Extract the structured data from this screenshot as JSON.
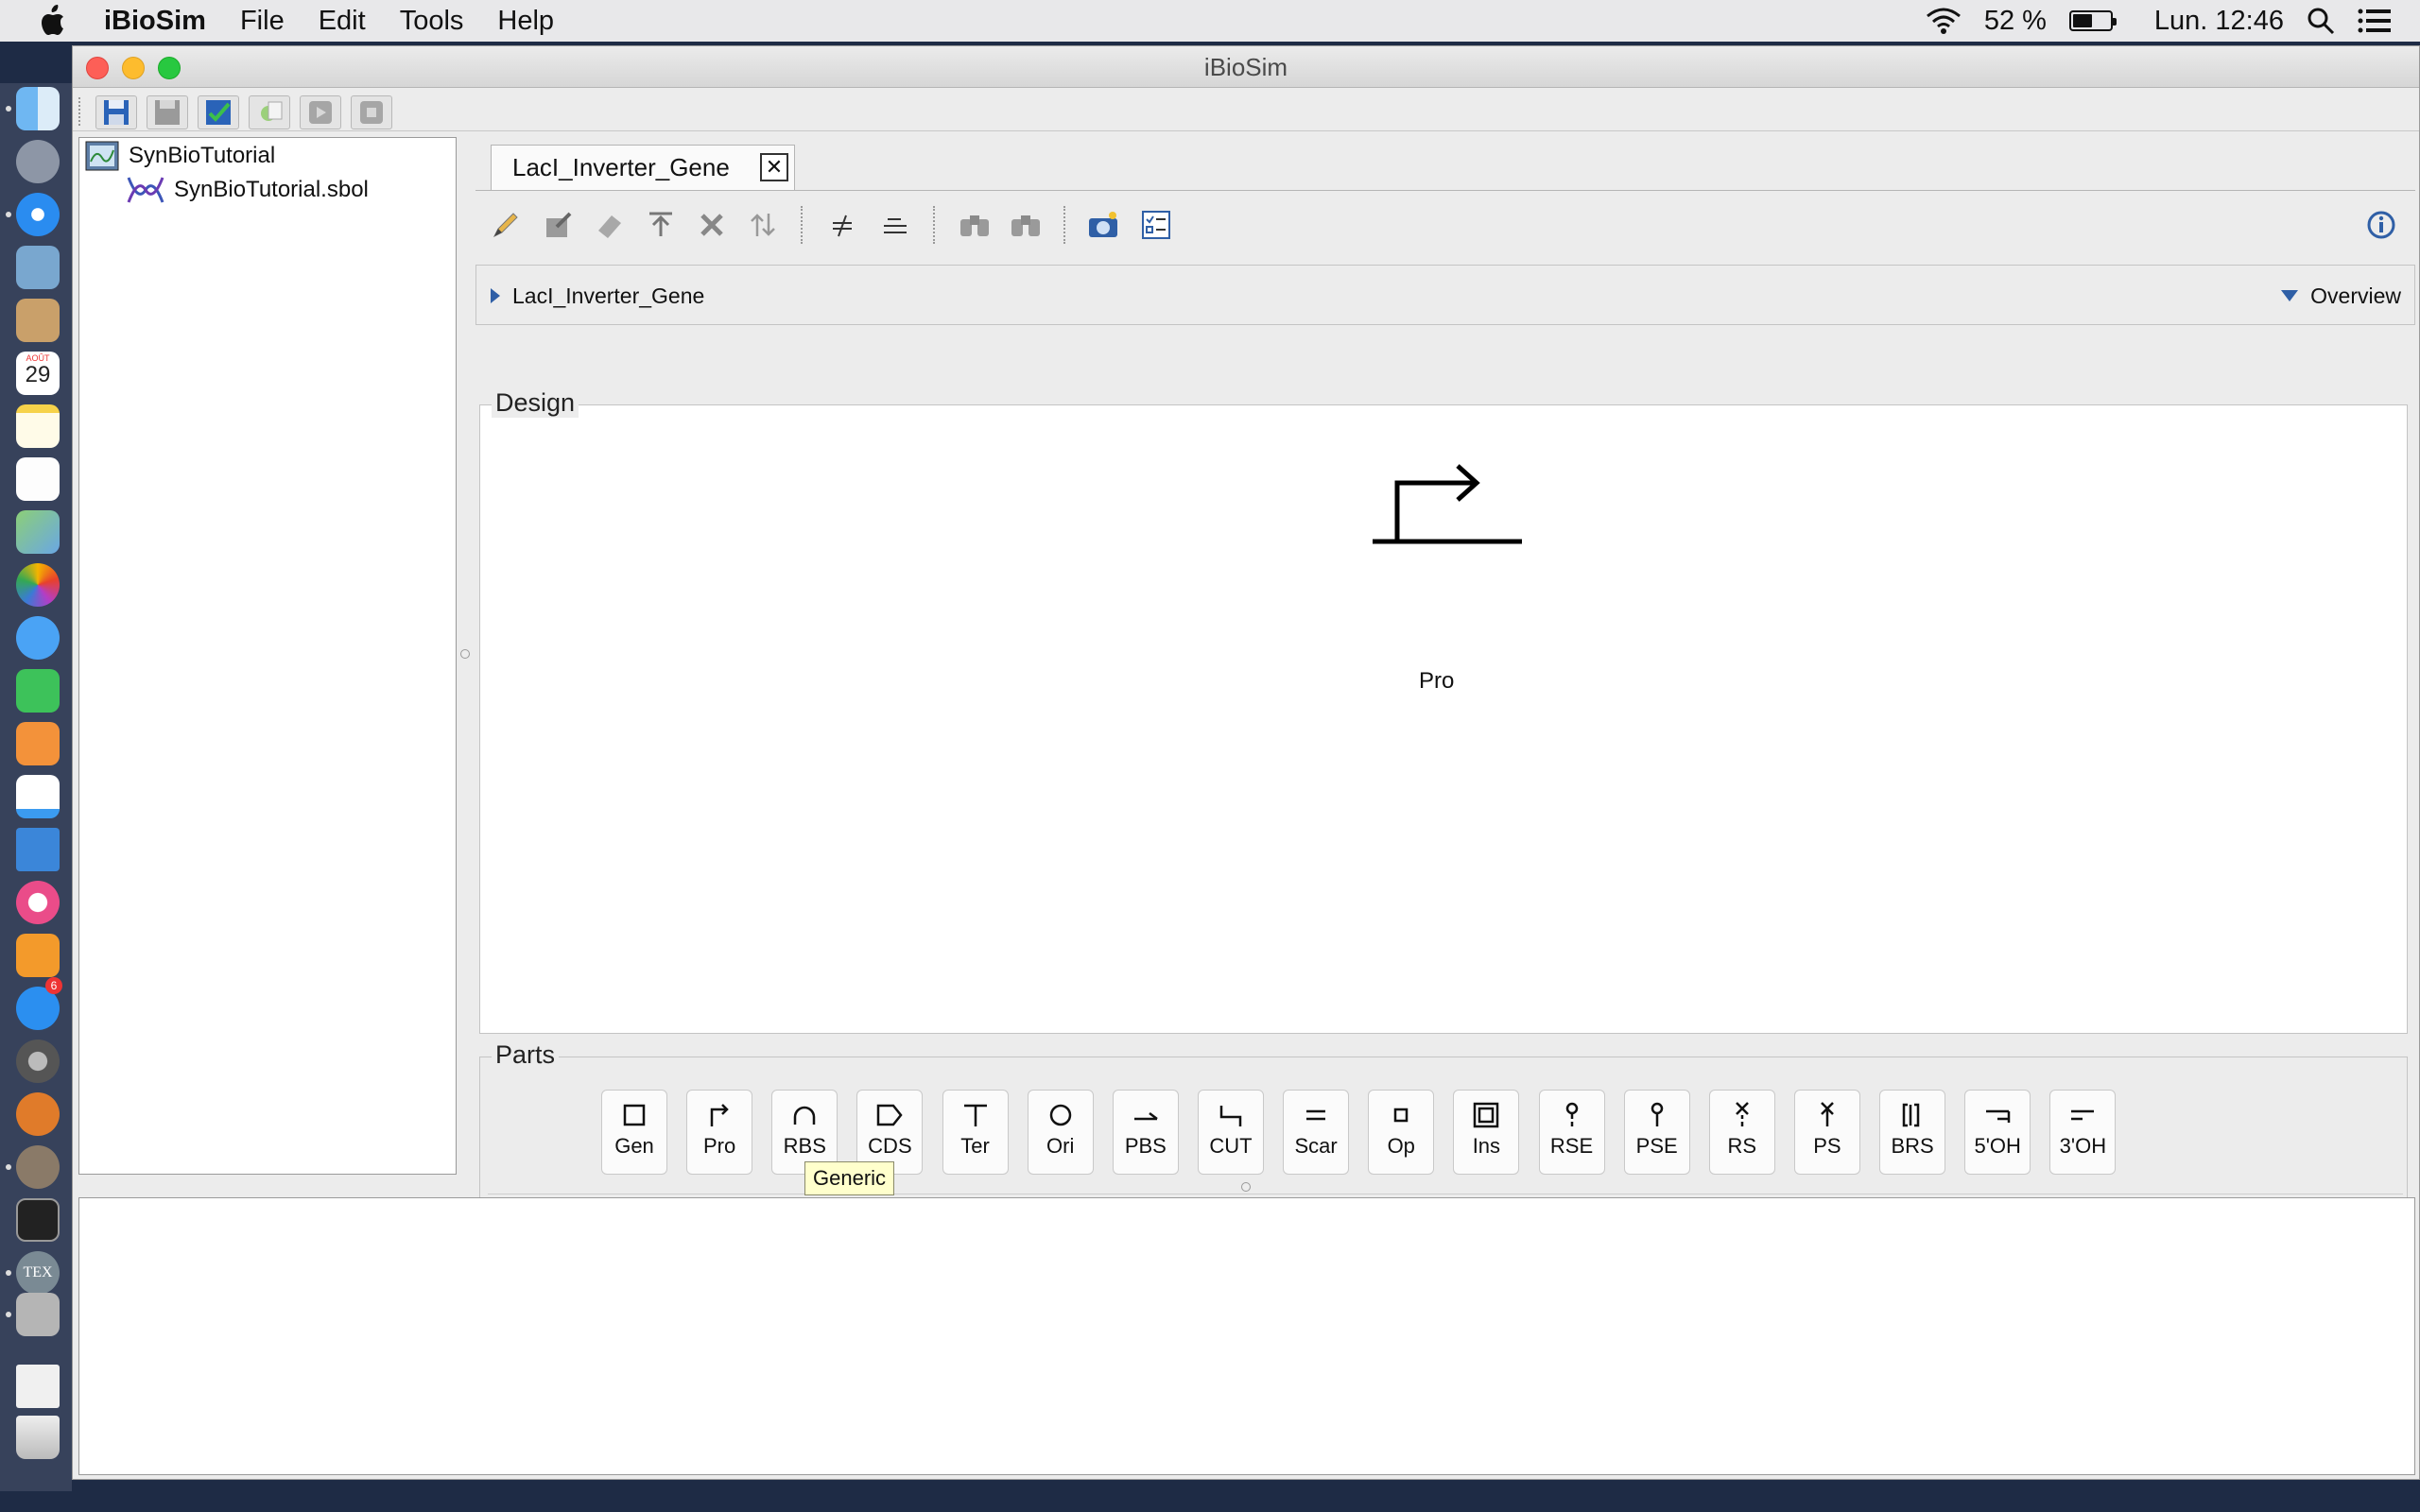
{
  "menubar": {
    "app_name": "iBioSim",
    "menus": [
      "File",
      "Edit",
      "Tools",
      "Help"
    ],
    "battery_percent": "52 %",
    "clock": "Lun. 12:46",
    "battery_level": 0.52
  },
  "window": {
    "title": "iBioSim"
  },
  "project_tree": {
    "root": "SynBioTutorial",
    "child": "SynBioTutorial.sbol"
  },
  "editor": {
    "tab_label": "LacI_Inverter_Gene",
    "tab_close_glyph": "✕",
    "breadcrumb": "LacI_Inverter_Gene",
    "view_selector": "Overview",
    "design_title": "Design",
    "design_part_label": "Pro",
    "parts_title": "Parts",
    "parts": [
      "Gen",
      "Pro",
      "RBS",
      "CDS",
      "Ter",
      "Ori",
      "PBS",
      "CUT",
      "Scar",
      "Op",
      "Ins",
      "RSE",
      "PSE",
      "RS",
      "PS",
      "BRS",
      "5'OH",
      "3'OH"
    ],
    "tooltip": "Generic"
  },
  "dock": {
    "calendar_month": "AOÛT",
    "calendar_day": "29",
    "appstore_badge": "6",
    "tex_label": "TEX"
  },
  "icons": {
    "apple": "apple-logo-icon",
    "wifi": "wifi-icon",
    "search": "spotlight-search-icon",
    "notifications": "notification-center-icon",
    "info": "info-icon"
  }
}
